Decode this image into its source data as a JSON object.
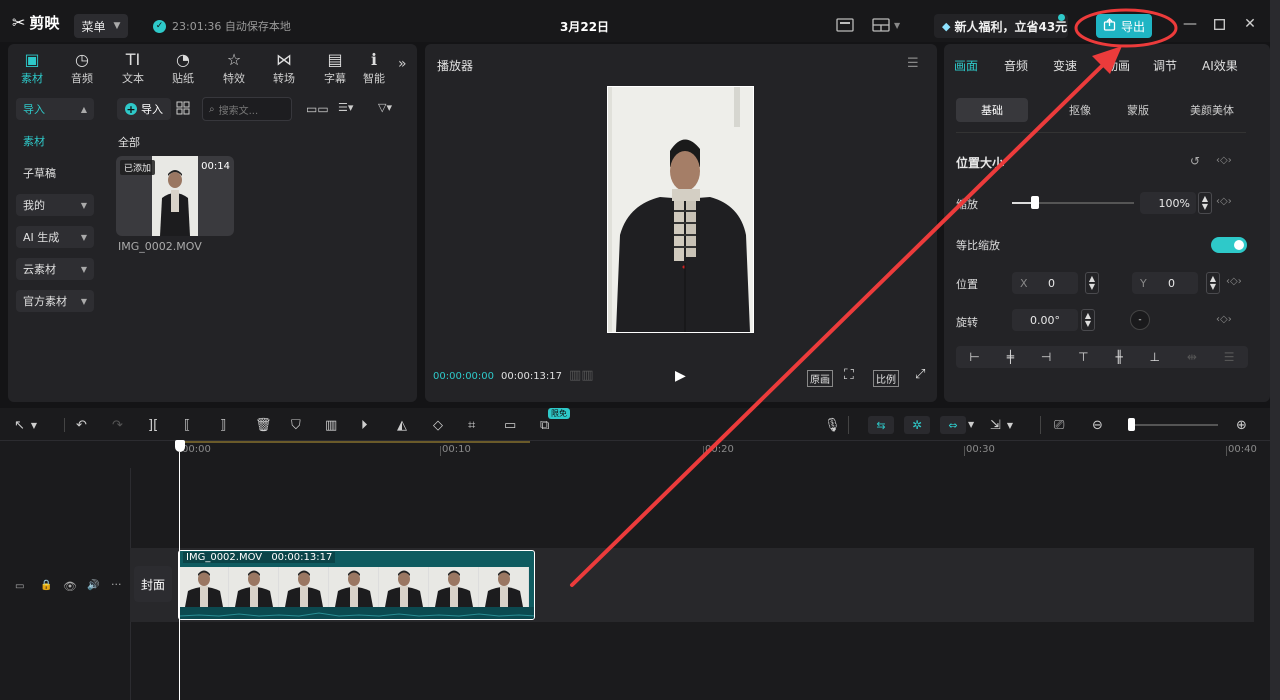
{
  "titlebar": {
    "logo": "剪映",
    "menu_label": "菜单",
    "save_status": "23:01:36 自动保存本地",
    "project_title": "3月22日",
    "promo": "新人福利，立省43元",
    "export_label": "导出"
  },
  "media_tabs": [
    {
      "label": "素材",
      "icon": "media-icon"
    },
    {
      "label": "音频",
      "icon": "audio-icon"
    },
    {
      "label": "文本",
      "icon": "text-icon"
    },
    {
      "label": "贴纸",
      "icon": "sticker-icon"
    },
    {
      "label": "特效",
      "icon": "effects-icon"
    },
    {
      "label": "转场",
      "icon": "transition-icon"
    },
    {
      "label": "字幕",
      "icon": "subtitle-icon"
    },
    {
      "label": "智能",
      "icon": "smart-icon"
    }
  ],
  "sidebar": {
    "items": [
      {
        "label": "导入"
      },
      {
        "label": "素材"
      },
      {
        "label": "子草稿"
      },
      {
        "label": "我的"
      },
      {
        "label": "AI 生成"
      },
      {
        "label": "云素材"
      },
      {
        "label": "官方素材"
      }
    ]
  },
  "media": {
    "import_label": "导入",
    "search_placeholder": "搜索文...",
    "section_label": "全部",
    "items": [
      {
        "name": "IMG_0002.MOV",
        "badge": "已添加",
        "duration": "00:14"
      }
    ]
  },
  "player": {
    "title": "播放器",
    "current_time": "00:00:00:00",
    "total_time": "00:00:13:17",
    "btn_original": "原画",
    "btn_ratio": "比例"
  },
  "props": {
    "tabs": [
      "画面",
      "音频",
      "变速",
      "动画",
      "调节",
      "AI效果"
    ],
    "subtabs": [
      "基础",
      "抠像",
      "蒙版",
      "美颜美体"
    ],
    "section_title": "位置大小",
    "scale_label": "缩放",
    "scale_value": "100%",
    "scale_level": 1.0,
    "uniform_scale_label": "等比缩放",
    "uniform_scale_on": true,
    "position_label": "位置",
    "x_label": "X",
    "x_value": "0",
    "y_label": "Y",
    "y_value": "0",
    "rotation_label": "旋转",
    "rotation_value": "0.00°"
  },
  "timeline": {
    "limited_badge": "限免",
    "ruler": [
      "00:00",
      "00:10",
      "00:20",
      "00:30",
      "00:40"
    ],
    "cover_label": "封面",
    "clip_name": "IMG_0002.MOV",
    "clip_duration": "00:00:13:17"
  },
  "colors": {
    "accent": "#2ec9c9",
    "export_button": "#1fb5c4",
    "annotation": "#ec3b3b",
    "clip": "#0f5b60"
  }
}
